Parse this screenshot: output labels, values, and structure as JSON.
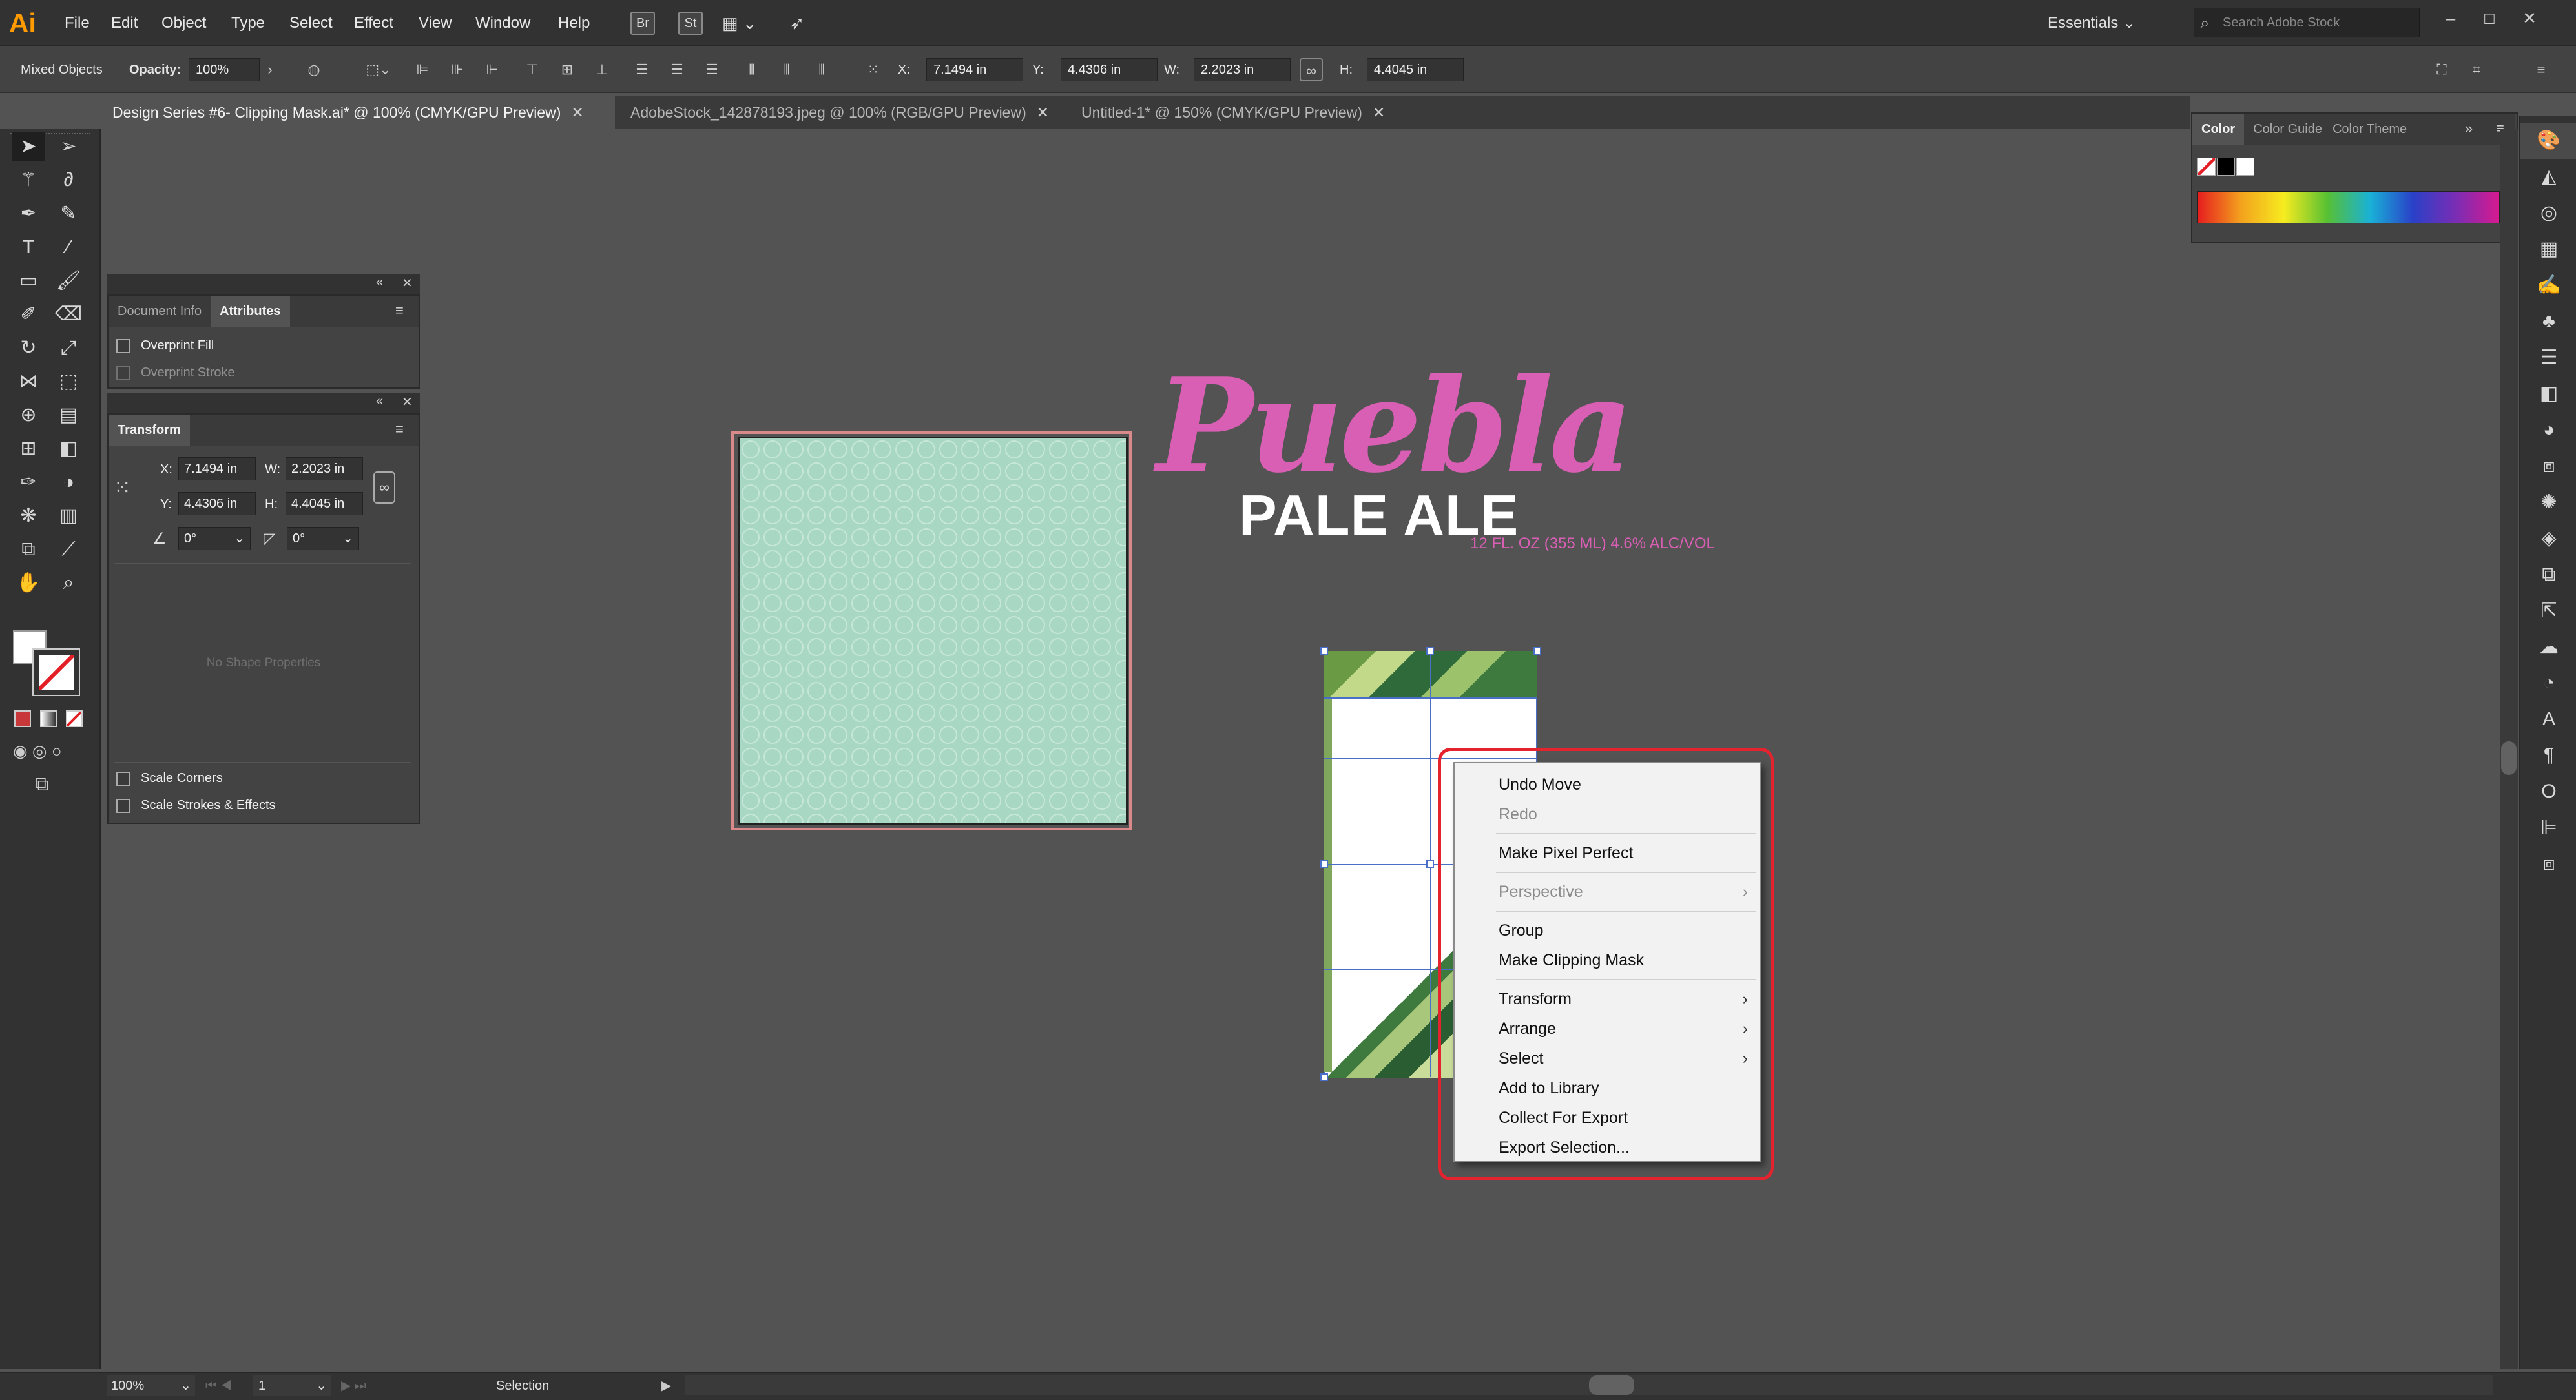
{
  "app": {
    "logo": "Ai"
  },
  "menu": [
    "File",
    "Edit",
    "Object",
    "Type",
    "Select",
    "Effect",
    "View",
    "Window",
    "Help"
  ],
  "toolbar_icons": [
    "br-icon",
    "st-icon",
    "arrange-docs-icon",
    "gpu-rocket-icon"
  ],
  "workspace": "Essentials",
  "stock_search_placeholder": "Search Adobe Stock",
  "control_bar": {
    "selection_type": "Mixed Objects",
    "opacity_label": "Opacity:",
    "opacity_value": "100%",
    "x_label": "X:",
    "x_value": "7.1494 in",
    "y_label": "Y:",
    "y_value": "4.4306 in",
    "w_label": "W:",
    "w_value": "2.2023 in",
    "h_label": "H:",
    "h_value": "4.4045 in"
  },
  "tabs": [
    {
      "label": "Design Series #6- Clipping Mask.ai* @ 100% (CMYK/GPU Preview)",
      "active": true
    },
    {
      "label": "AdobeStock_142878193.jpeg @ 100% (RGB/GPU Preview)",
      "active": false
    },
    {
      "label": "Untitled-1* @ 150% (CMYK/GPU Preview)",
      "active": false
    }
  ],
  "attributes_panel": {
    "tabs": [
      "Document Info",
      "Attributes"
    ],
    "overprint_fill": "Overprint Fill",
    "overprint_stroke": "Overprint Stroke"
  },
  "transform_panel": {
    "title": "Transform",
    "x_label": "X:",
    "x_value": "7.1494 in",
    "y_label": "Y:",
    "y_value": "4.4306 in",
    "w_label": "W:",
    "w_value": "2.2023 in",
    "h_label": "H:",
    "h_value": "4.4045 in",
    "rotate_value": "0°",
    "shear_value": "0°",
    "no_shape": "No Shape Properties",
    "scale_corners": "Scale Corners",
    "scale_strokes": "Scale Strokes & Effects"
  },
  "color_panel": {
    "tabs": [
      "Color",
      "Color Guide",
      "Color Theme"
    ]
  },
  "artwork": {
    "title": "Puebla",
    "subtitle": "PALE ALE",
    "detail": "12 FL. OZ (355 ML) 4.6% ALC/VOL"
  },
  "context_menu": {
    "items": [
      {
        "label": "Undo Move",
        "disabled": false,
        "submenu": false
      },
      {
        "label": "Redo",
        "disabled": true,
        "submenu": false
      },
      {
        "sep": true
      },
      {
        "label": "Make Pixel Perfect",
        "disabled": false,
        "submenu": false
      },
      {
        "sep": true
      },
      {
        "label": "Perspective",
        "disabled": true,
        "submenu": true
      },
      {
        "sep": true
      },
      {
        "label": "Group",
        "disabled": false,
        "submenu": false
      },
      {
        "label": "Make Clipping Mask",
        "disabled": false,
        "submenu": false
      },
      {
        "sep": true
      },
      {
        "label": "Transform",
        "disabled": false,
        "submenu": true
      },
      {
        "label": "Arrange",
        "disabled": false,
        "submenu": true
      },
      {
        "label": "Select",
        "disabled": false,
        "submenu": true
      },
      {
        "label": "Add to Library",
        "disabled": false,
        "submenu": false
      },
      {
        "label": "Collect For Export",
        "disabled": false,
        "submenu": false
      },
      {
        "label": "Export Selection...",
        "disabled": false,
        "submenu": false
      }
    ]
  },
  "status": {
    "zoom": "100%",
    "artboard": "1",
    "tool": "Selection"
  },
  "colors": {
    "accent_pink": "#d85fb3",
    "highlight_red": "#e5232f",
    "selection_blue": "#4a6fc9"
  }
}
